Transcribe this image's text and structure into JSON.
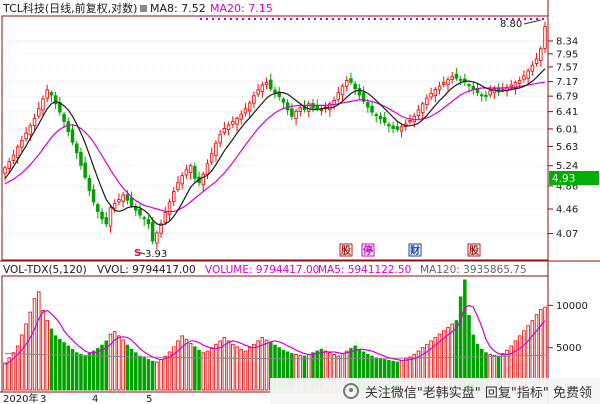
{
  "header": {
    "title": "TCL科技(日线,前复权,对数)",
    "ma8": "MA8: 7.52",
    "ma20": "MA20: 7.15"
  },
  "volume_header": {
    "indicator": "VOL-TDX(5,120)",
    "vvol": "VVOL: 9794417.00",
    "volume": "VOLUME: 9794417.00",
    "ma5": "MA5: 5941122.50",
    "ma120": "MA120: 3935865.75"
  },
  "annotations": {
    "high": "8.80",
    "low": "3.93",
    "current": "4.93",
    "year_label": "2020年",
    "month_labels": [
      "3",
      "4",
      "5"
    ]
  },
  "markers": [
    {
      "glyph": "S",
      "color": "#e8102a"
    },
    {
      "glyph": "股",
      "color": "#a02020"
    },
    {
      "glyph": "停",
      "color": "#cc00cc"
    },
    {
      "glyph": "财",
      "color": "#1f3fa8"
    },
    {
      "glyph": "股",
      "color": "#a02020"
    }
  ],
  "watermark": "关注微信\"老韩实盘\" 回复\"指标\" 免费领",
  "colors": {
    "up": "#ee1111",
    "down": "#00a000",
    "ma8": "#1a1a1a",
    "ma20": "#d400d4",
    "vol_ma5": "#d400d4",
    "vol_ma120": "#888888",
    "current_box": "#00b000"
  },
  "chart_data": [
    {
      "type": "candlestick",
      "y_scale": "log",
      "ylim": [
        3.8,
        8.95
      ],
      "y_ticks": [
        "8.34",
        "7.95",
        "7.57",
        "7.17",
        "6.79",
        "6.41",
        "6.01",
        "5.63",
        "5.24",
        "4.86",
        "4.46",
        "4.07"
      ],
      "close": [
        5.2,
        5.32,
        5.45,
        5.62,
        5.76,
        5.92,
        6.08,
        6.25,
        6.48,
        6.72,
        6.95,
        6.82,
        6.6,
        6.4,
        6.18,
        5.95,
        5.72,
        5.5,
        5.25,
        5.02,
        4.78,
        4.58,
        4.42,
        4.3,
        4.22,
        4.48,
        4.55,
        4.62,
        4.7,
        4.61,
        4.52,
        4.44,
        4.36,
        4.3,
        4.22,
        3.96,
        4.08,
        4.22,
        4.4,
        4.58,
        4.76,
        4.92,
        5.05,
        5.16,
        5.24,
        5.0,
        4.92,
        5.08,
        5.28,
        5.48,
        5.7,
        5.88,
        6.02,
        6.1,
        6.18,
        6.25,
        6.35,
        6.48,
        6.62,
        6.8,
        6.95,
        7.08,
        7.15,
        6.98,
        6.88,
        6.78,
        6.64,
        6.45,
        6.3,
        6.42,
        6.5,
        6.46,
        6.6,
        6.5,
        6.48,
        6.46,
        6.52,
        6.6,
        6.68,
        6.88,
        7.05,
        7.2,
        7.15,
        6.98,
        6.82,
        6.66,
        6.52,
        6.4,
        6.32,
        6.24,
        6.16,
        6.08,
        6.02,
        6.0,
        6.06,
        6.12,
        6.2,
        6.3,
        6.45,
        6.6,
        6.74,
        6.86,
        6.96,
        7.05,
        7.14,
        7.22,
        7.3,
        7.26,
        7.22,
        7.16,
        7.06,
        6.96,
        6.88,
        6.82,
        6.78,
        6.92,
        6.98,
        6.9,
        6.96,
        7.02,
        7.08,
        7.14,
        7.2,
        7.32,
        7.46,
        7.62,
        7.8,
        8.1,
        8.8
      ],
      "ma8": [
        5.0,
        5.1,
        5.22,
        5.36,
        5.5,
        5.64,
        5.8,
        5.96,
        6.12,
        6.3,
        6.48,
        6.6,
        6.66,
        6.62,
        6.55,
        6.45,
        6.3,
        6.12,
        5.92,
        5.7,
        5.46,
        5.22,
        5.0,
        4.8,
        4.62,
        4.52,
        4.44,
        4.42,
        4.44,
        4.48,
        4.5,
        4.5,
        4.48,
        4.44,
        4.38,
        4.28,
        4.22,
        4.2,
        4.22,
        4.26,
        4.34,
        4.44,
        4.56,
        4.7,
        4.84,
        4.92,
        4.98,
        5.02,
        5.06,
        5.14,
        5.26,
        5.4,
        5.54,
        5.66,
        5.78,
        5.92,
        6.04,
        6.16,
        6.26,
        6.38,
        6.5,
        6.62,
        6.74,
        6.82,
        6.86,
        6.88,
        6.88,
        6.84,
        6.76,
        6.68,
        6.6,
        6.52,
        6.48,
        6.46,
        6.46,
        6.48,
        6.5,
        6.5,
        6.52,
        6.58,
        6.66,
        6.76,
        6.86,
        6.92,
        6.94,
        6.92,
        6.86,
        6.78,
        6.68,
        6.58,
        6.48,
        6.38,
        6.28,
        6.18,
        6.12,
        6.08,
        6.08,
        6.1,
        6.14,
        6.22,
        6.32,
        6.44,
        6.56,
        6.68,
        6.78,
        6.9,
        7.0,
        7.08,
        7.14,
        7.18,
        7.18,
        7.16,
        7.12,
        7.06,
        7.0,
        6.96,
        6.94,
        6.92,
        6.92,
        6.94,
        6.96,
        6.98,
        7.0,
        7.04,
        7.1,
        7.18,
        7.28,
        7.4,
        7.52
      ],
      "ma20": [
        4.9,
        4.94,
        4.98,
        5.04,
        5.1,
        5.18,
        5.26,
        5.36,
        5.46,
        5.58,
        5.7,
        5.82,
        5.92,
        6.0,
        6.06,
        6.1,
        6.1,
        6.08,
        6.02,
        5.94,
        5.84,
        5.72,
        5.58,
        5.44,
        5.3,
        5.16,
        5.04,
        4.92,
        4.82,
        4.74,
        4.66,
        4.6,
        4.56,
        4.52,
        4.5,
        4.48,
        4.46,
        4.44,
        4.42,
        4.42,
        4.42,
        4.44,
        4.48,
        4.52,
        4.58,
        4.64,
        4.7,
        4.76,
        4.82,
        4.88,
        4.94,
        5.02,
        5.1,
        5.2,
        5.3,
        5.42,
        5.54,
        5.66,
        5.78,
        5.9,
        6.02,
        6.12,
        6.22,
        6.3,
        6.38,
        6.44,
        6.48,
        6.52,
        6.54,
        6.55,
        6.56,
        6.56,
        6.56,
        6.56,
        6.56,
        6.56,
        6.56,
        6.57,
        6.58,
        6.6,
        6.62,
        6.64,
        6.66,
        6.68,
        6.7,
        6.7,
        6.68,
        6.66,
        6.62,
        6.58,
        6.54,
        6.48,
        6.42,
        6.36,
        6.3,
        6.26,
        6.24,
        6.22,
        6.22,
        6.24,
        6.26,
        6.3,
        6.36,
        6.42,
        6.5,
        6.58,
        6.66,
        6.74,
        6.82,
        6.88,
        6.92,
        6.96,
        6.98,
        7.0,
        7.0,
        7.0,
        7.0,
        7.0,
        7.0,
        7.0,
        7.0,
        7.02,
        7.04,
        7.06,
        7.08,
        7.1,
        7.12,
        7.14,
        7.15
      ]
    },
    {
      "type": "bar",
      "ylim": [
        0,
        13000
      ],
      "y_ticks": [
        "10000",
        "5000"
      ],
      "volume": [
        3200,
        3800,
        4400,
        5200,
        6500,
        7800,
        9200,
        10800,
        11600,
        9400,
        8200,
        7200,
        6400,
        6000,
        5600,
        5200,
        4800,
        4400,
        4200,
        4000,
        4300,
        4600,
        4900,
        5300,
        5800,
        6600,
        6900,
        6400,
        5900,
        5300,
        4800,
        4400,
        4000,
        3800,
        3600,
        3400,
        3300,
        3600,
        4000,
        4500,
        5100,
        5800,
        6400,
        6000,
        5500,
        5100,
        4700,
        4400,
        4600,
        5000,
        5400,
        5800,
        6200,
        5800,
        5400,
        5100,
        4800,
        4600,
        5000,
        5400,
        5800,
        6200,
        5900,
        5600,
        5300,
        5000,
        4700,
        4500,
        4300,
        4200,
        4100,
        4000,
        4200,
        4400,
        4600,
        4800,
        4600,
        4400,
        4200,
        4000,
        4300,
        4600,
        4900,
        5200,
        4800,
        4500,
        4200,
        4000,
        3800,
        3700,
        3600,
        3500,
        3400,
        3300,
        3500,
        3700,
        3900,
        4200,
        4600,
        5000,
        5400,
        5800,
        6200,
        6600,
        7000,
        7400,
        7800,
        8200,
        11000,
        14000,
        8800,
        6500,
        5400,
        4800,
        4400,
        4200,
        4100,
        4000,
        4300,
        4700,
        5200,
        5800,
        6400,
        7000,
        7600,
        8200,
        8900,
        9500,
        9794
      ],
      "ma5": [
        3000,
        3300,
        3700,
        4200,
        4700,
        5400,
        6200,
        7200,
        8400,
        9200,
        9400,
        9000,
        8500,
        7900,
        7000,
        6400,
        5900,
        5400,
        5000,
        4600,
        4400,
        4400,
        4500,
        4700,
        5000,
        5400,
        5900,
        6200,
        6300,
        6200,
        5900,
        5400,
        4900,
        4500,
        4200,
        3900,
        3700,
        3600,
        3700,
        3900,
        4200,
        4600,
        5100,
        5500,
        5800,
        5800,
        5600,
        5300,
        5100,
        4900,
        4900,
        5000,
        5300,
        5600,
        5800,
        5700,
        5500,
        5300,
        5100,
        5000,
        5100,
        5300,
        5500,
        5700,
        5800,
        5700,
        5500,
        5200,
        5000,
        4700,
        4500,
        4300,
        4200,
        4200,
        4300,
        4400,
        4500,
        4500,
        4500,
        4400,
        4300,
        4400,
        4500,
        4700,
        4800,
        4800,
        4700,
        4600,
        4400,
        4200,
        4000,
        3800,
        3700,
        3600,
        3500,
        3500,
        3600,
        3700,
        3900,
        4200,
        4500,
        4900,
        5300,
        5700,
        6100,
        6500,
        6900,
        7300,
        8200,
        9700,
        10000,
        9800,
        8700,
        7500,
        6000,
        5100,
        4600,
        4300,
        4200,
        4200,
        4300,
        4600,
        4900,
        5300,
        5800,
        6400,
        7000,
        7600,
        8200
      ]
    }
  ]
}
